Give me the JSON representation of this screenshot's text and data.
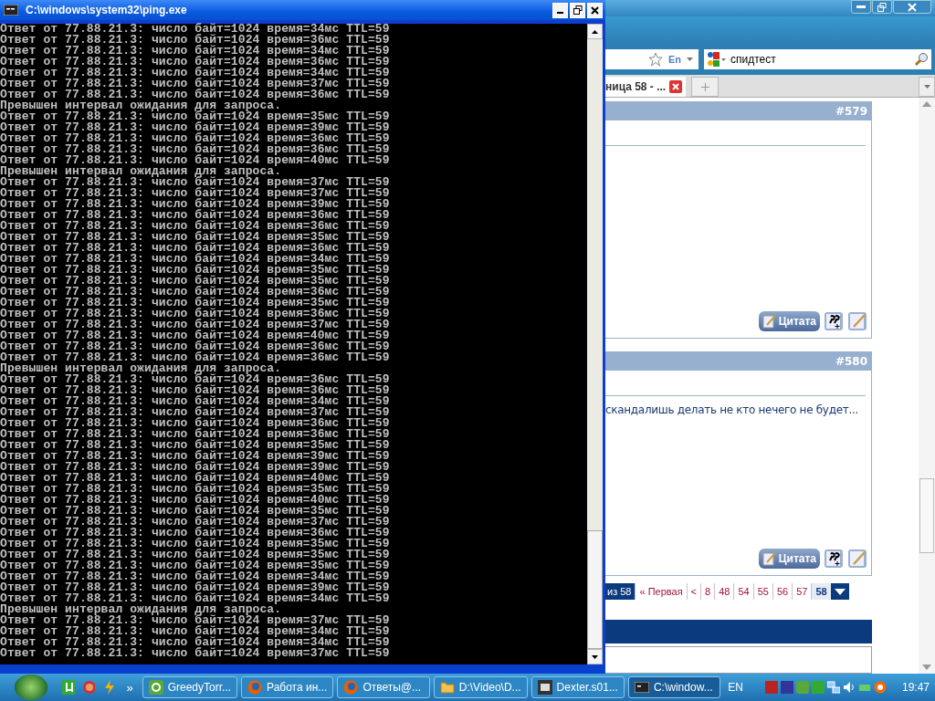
{
  "console": {
    "title": "C:\\windows\\system32\\ping.exe",
    "lines": [
      "Ответ от 77.88.21.3: число байт=1024 время=34мс TTL=59",
      "Ответ от 77.88.21.3: число байт=1024 время=36мс TTL=59",
      "Ответ от 77.88.21.3: число байт=1024 время=34мс TTL=59",
      "Ответ от 77.88.21.3: число байт=1024 время=36мс TTL=59",
      "Ответ от 77.88.21.3: число байт=1024 время=34мс TTL=59",
      "Ответ от 77.88.21.3: число байт=1024 время=37мс TTL=59",
      "Ответ от 77.88.21.3: число байт=1024 время=36мс TTL=59",
      "Превышен интервал ожидания для запроса.",
      "Ответ от 77.88.21.3: число байт=1024 время=35мс TTL=59",
      "Ответ от 77.88.21.3: число байт=1024 время=39мс TTL=59",
      "Ответ от 77.88.21.3: число байт=1024 время=36мс TTL=59",
      "Ответ от 77.88.21.3: число байт=1024 время=36мс TTL=59",
      "Ответ от 77.88.21.3: число байт=1024 время=40мс TTL=59",
      "Превышен интервал ожидания для запроса.",
      "Ответ от 77.88.21.3: число байт=1024 время=37мс TTL=59",
      "Ответ от 77.88.21.3: число байт=1024 время=37мс TTL=59",
      "Ответ от 77.88.21.3: число байт=1024 время=39мс TTL=59",
      "Ответ от 77.88.21.3: число байт=1024 время=36мс TTL=59",
      "Ответ от 77.88.21.3: число байт=1024 время=36мс TTL=59",
      "Ответ от 77.88.21.3: число байт=1024 время=35мс TTL=59",
      "Ответ от 77.88.21.3: число байт=1024 время=36мс TTL=59",
      "Ответ от 77.88.21.3: число байт=1024 время=34мс TTL=59",
      "Ответ от 77.88.21.3: число байт=1024 время=35мс TTL=59",
      "Ответ от 77.88.21.3: число байт=1024 время=35мс TTL=59",
      "Ответ от 77.88.21.3: число байт=1024 время=36мс TTL=59",
      "Ответ от 77.88.21.3: число байт=1024 время=35мс TTL=59",
      "Ответ от 77.88.21.3: число байт=1024 время=36мс TTL=59",
      "Ответ от 77.88.21.3: число байт=1024 время=37мс TTL=59",
      "Ответ от 77.88.21.3: число байт=1024 время=40мс TTL=59",
      "Ответ от 77.88.21.3: число байт=1024 время=36мс TTL=59",
      "Ответ от 77.88.21.3: число байт=1024 время=36мс TTL=59",
      "Превышен интервал ожидания для запроса.",
      "Ответ от 77.88.21.3: число байт=1024 время=36мс TTL=59",
      "Ответ от 77.88.21.3: число байт=1024 время=36мс TTL=59",
      "Ответ от 77.88.21.3: число байт=1024 время=34мс TTL=59",
      "Ответ от 77.88.21.3: число байт=1024 время=37мс TTL=59",
      "Ответ от 77.88.21.3: число байт=1024 время=36мс TTL=59",
      "Ответ от 77.88.21.3: число байт=1024 время=36мс TTL=59",
      "Ответ от 77.88.21.3: число байт=1024 время=35мс TTL=59",
      "Ответ от 77.88.21.3: число байт=1024 время=39мс TTL=59",
      "Ответ от 77.88.21.3: число байт=1024 время=39мс TTL=59",
      "Ответ от 77.88.21.3: число байт=1024 время=40мс TTL=59",
      "Ответ от 77.88.21.3: число байт=1024 время=35мс TTL=59",
      "Ответ от 77.88.21.3: число байт=1024 время=40мс TTL=59",
      "Ответ от 77.88.21.3: число байт=1024 время=35мс TTL=59",
      "Ответ от 77.88.21.3: число байт=1024 время=37мс TTL=59",
      "Ответ от 77.88.21.3: число байт=1024 время=36мс TTL=59",
      "Ответ от 77.88.21.3: число байт=1024 время=35мс TTL=59",
      "Ответ от 77.88.21.3: число байт=1024 время=35мс TTL=59",
      "Ответ от 77.88.21.3: число байт=1024 время=35мс TTL=59",
      "Ответ от 77.88.21.3: число байт=1024 время=34мс TTL=59",
      "Ответ от 77.88.21.3: число байт=1024 время=39мс TTL=59",
      "Ответ от 77.88.21.3: число байт=1024 время=34мс TTL=59",
      "Превышен интервал ожидания для запроса.",
      "Ответ от 77.88.21.3: число байт=1024 время=37мс TTL=59",
      "Ответ от 77.88.21.3: число байт=1024 время=34мс TTL=59",
      "Ответ от 77.88.21.3: число байт=1024 время=34мс TTL=59",
      "Ответ от 77.88.21.3: число байт=1024 время=37мс TTL=59"
    ]
  },
  "browser": {
    "lang_label": "En",
    "search": {
      "value": "спидтест"
    },
    "tabs": [
      {
        "label": "ница 58 - ...",
        "selected": true
      }
    ],
    "posts": [
      {
        "number": "#579",
        "quote_label": "Цитата"
      },
      {
        "number": "#580",
        "text": "скандалишь делать не кто нечего не будет...",
        "quote_label": "Цитата"
      }
    ],
    "pagination": {
      "summary": "из 58",
      "first": "« Первая",
      "prev": "<",
      "pages": [
        {
          "label": "8",
          "selected": false
        },
        {
          "label": "48",
          "selected": false
        },
        {
          "label": "54",
          "selected": false
        },
        {
          "label": "55",
          "selected": false
        },
        {
          "label": "56",
          "selected": false
        },
        {
          "label": "57",
          "selected": false
        },
        {
          "label": "58",
          "selected": true
        }
      ]
    }
  },
  "taskbar": {
    "more": "»",
    "tasks": [
      {
        "label": "GreedyTorr...",
        "kind": "torrent",
        "selected": false
      },
      {
        "label": "Работа ин...",
        "kind": "firefox",
        "selected": false
      },
      {
        "label": "Ответы@...",
        "kind": "firefox",
        "selected": false
      },
      {
        "label": "D:\\Video\\D...",
        "kind": "folder",
        "selected": false
      },
      {
        "label": "Dexter.s01...",
        "kind": "video",
        "selected": false
      },
      {
        "label": "C:\\window...",
        "kind": "console",
        "selected": true
      }
    ],
    "language": "EN",
    "clock": "19:47"
  }
}
